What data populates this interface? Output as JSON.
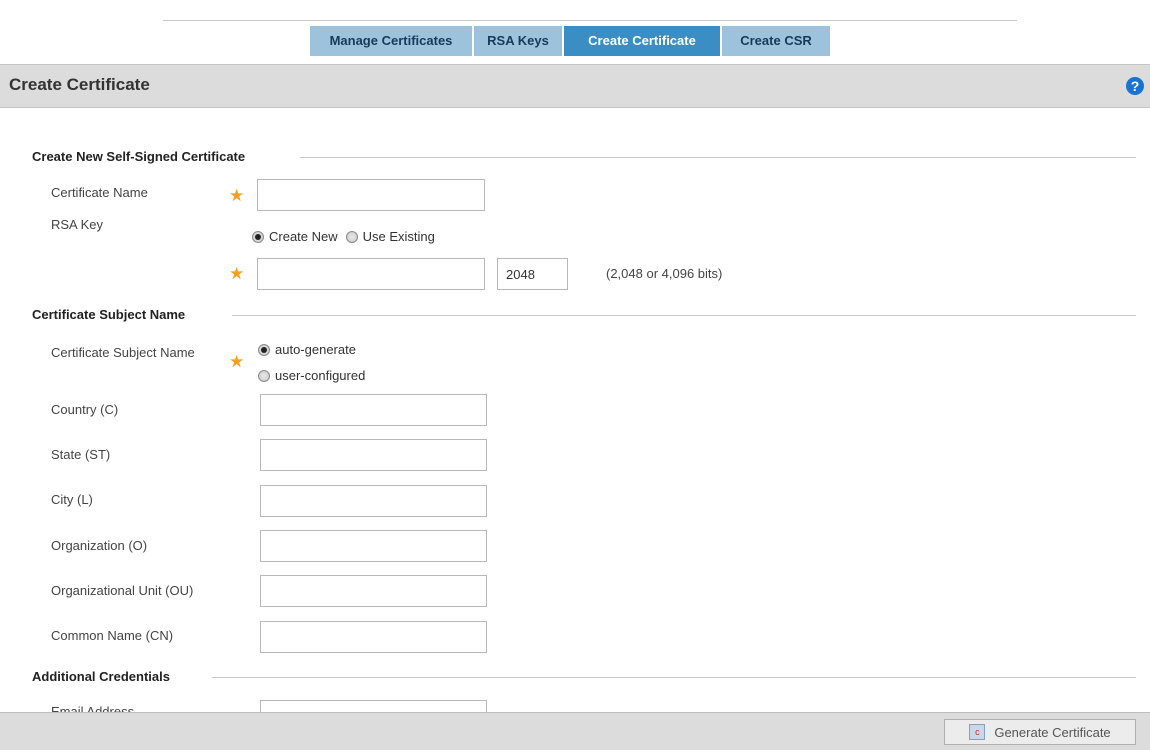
{
  "tabs": [
    {
      "label": "Manage Certificates"
    },
    {
      "label": "RSA Keys"
    },
    {
      "label": "Create Certificate"
    },
    {
      "label": "Create CSR"
    }
  ],
  "header": {
    "title": "Create Certificate",
    "help": "?"
  },
  "sections": {
    "self_signed": "Create New Self-Signed Certificate",
    "subject": "Certificate Subject Name",
    "additional": "Additional Credentials"
  },
  "form": {
    "certificate_name_label": "Certificate Name",
    "rsa_key_label": "RSA Key",
    "rsa_create_new": "Create New",
    "rsa_use_existing": "Use Existing",
    "key_size_value": "2048",
    "key_size_hint": "(2,048 or 4,096 bits)",
    "subject_label": "Certificate Subject Name",
    "auto_generate": "auto-generate",
    "user_configured": "user-configured",
    "country_label": "Country (C)",
    "state_label": "State (ST)",
    "city_label": "City (L)",
    "org_label": "Organization (O)",
    "org_unit_label": "Organizational Unit (OU)",
    "common_name_label": "Common Name (CN)",
    "email_label": "Email Address"
  },
  "footer": {
    "generate_label": "Generate Certificate"
  }
}
